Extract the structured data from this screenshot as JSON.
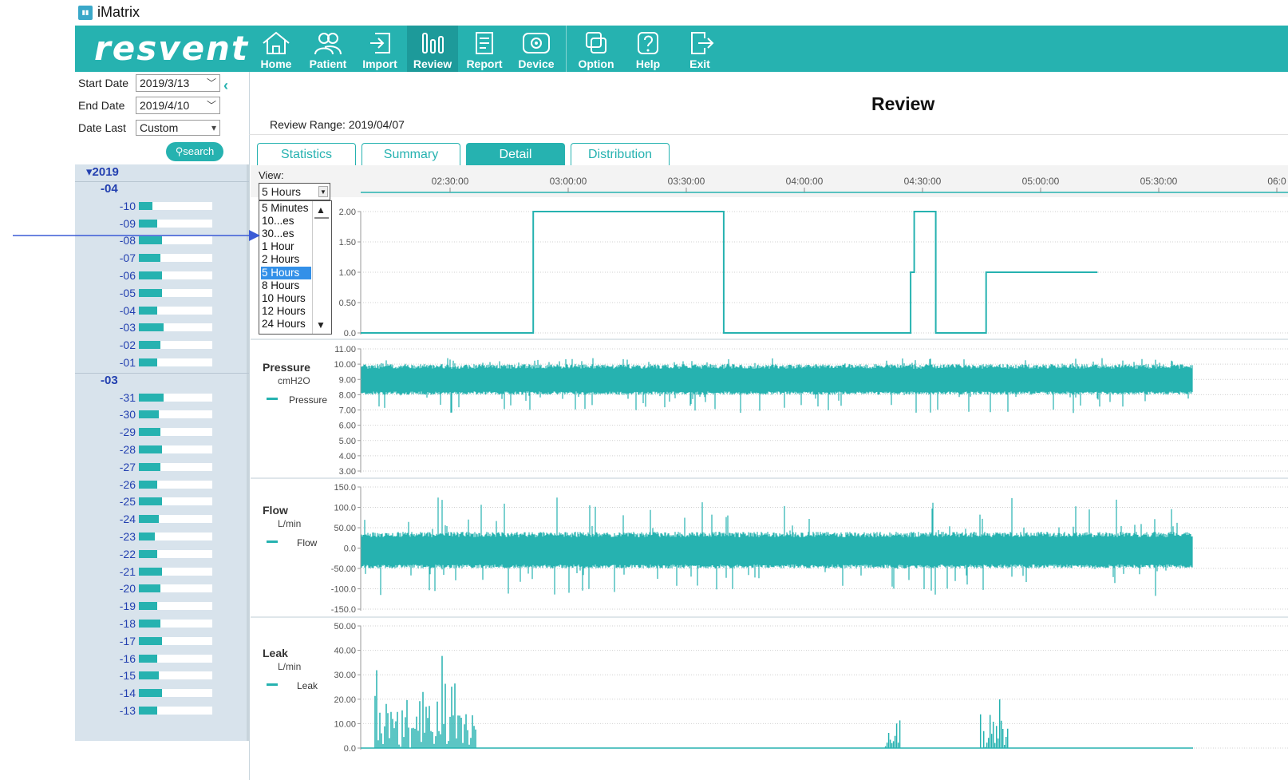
{
  "app": {
    "title": "iMatrix",
    "icon": "app-icon"
  },
  "brand": {
    "logo_text": "resvent",
    "accent_color": "#26b2b0",
    "active_color": "#1d9a9a"
  },
  "toolbar": {
    "items": [
      {
        "label": "Home",
        "icon": "home-icon"
      },
      {
        "label": "Patient",
        "icon": "patient-icon"
      },
      {
        "label": "Import",
        "icon": "import-icon"
      },
      {
        "label": "Review",
        "icon": "review-icon",
        "active": true
      },
      {
        "label": "Report",
        "icon": "report-icon"
      },
      {
        "label": "Device",
        "icon": "device-icon"
      },
      {
        "label": "Option",
        "icon": "option-icon"
      },
      {
        "label": "Help",
        "icon": "help-icon"
      },
      {
        "label": "Exit",
        "icon": "exit-icon"
      }
    ]
  },
  "filters": {
    "start_date_label": "Start Date",
    "start_date": "2019/3/13",
    "end_date_label": "End Date",
    "end_date": "2019/4/10",
    "date_last_label": "Date Last",
    "date_last": "Custom",
    "search_label": "search"
  },
  "tree": {
    "year": "2019",
    "months": [
      {
        "label": "04",
        "days": [
          {
            "d": "10",
            "v": 0.18
          },
          {
            "d": "09",
            "v": 0.25
          },
          {
            "d": "08",
            "v": 0.31
          },
          {
            "d": "07",
            "v": 0.29
          },
          {
            "d": "06",
            "v": 0.31
          },
          {
            "d": "05",
            "v": 0.31
          },
          {
            "d": "04",
            "v": 0.25
          },
          {
            "d": "03",
            "v": 0.34
          },
          {
            "d": "02",
            "v": 0.29
          },
          {
            "d": "01",
            "v": 0.25
          }
        ]
      },
      {
        "label": "03",
        "days": [
          {
            "d": "31",
            "v": 0.34
          },
          {
            "d": "30",
            "v": 0.27
          },
          {
            "d": "29",
            "v": 0.29
          },
          {
            "d": "28",
            "v": 0.31
          },
          {
            "d": "27",
            "v": 0.29
          },
          {
            "d": "26",
            "v": 0.25
          },
          {
            "d": "25",
            "v": 0.31
          },
          {
            "d": "24",
            "v": 0.27
          },
          {
            "d": "23",
            "v": 0.22
          },
          {
            "d": "22",
            "v": 0.25
          },
          {
            "d": "21",
            "v": 0.31
          },
          {
            "d": "20",
            "v": 0.29
          },
          {
            "d": "19",
            "v": 0.25
          },
          {
            "d": "18",
            "v": 0.29
          },
          {
            "d": "17",
            "v": 0.31
          },
          {
            "d": "16",
            "v": 0.25
          },
          {
            "d": "15",
            "v": 0.27
          },
          {
            "d": "14",
            "v": 0.31
          },
          {
            "d": "13",
            "v": 0.25
          }
        ]
      }
    ]
  },
  "main": {
    "title": "Review",
    "review_range": "Review Range: 2019/04/07",
    "tabs": [
      {
        "label": "Statistics",
        "active": false
      },
      {
        "label": "Summary",
        "active": false
      },
      {
        "label": "Detail",
        "active": true
      },
      {
        "label": "Distribution",
        "active": false
      }
    ]
  },
  "view": {
    "label": "View:",
    "selected": "5 Hours",
    "options": [
      "5 Minutes",
      "10...es",
      "30...es",
      "1 Hour",
      "2 Hours",
      "5 Hours",
      "8 Hours",
      "10 Hours",
      "12 Hours",
      "24 Hours"
    ]
  },
  "chart_data": [
    {
      "type": "line",
      "title": "",
      "x_ticks": [
        "02:30:00",
        "03:00:00",
        "03:30:00",
        "04:00:00",
        "04:30:00",
        "05:00:00",
        "05:30:00",
        "06:0"
      ],
      "x_range": [
        "02:12:00",
        "06:30:00"
      ],
      "y_ticks": [
        "2.00",
        "1.50",
        "1.00",
        "0.50",
        "0.0"
      ],
      "ylim": [
        0,
        2
      ],
      "series": [
        {
          "x": [
            "02:12:00",
            "03:00:00",
            "03:00:00",
            "03:53:00",
            "03:53:00",
            "04:45:00",
            "04:45:00",
            "04:46:00",
            "04:46:00",
            "04:52:00",
            "04:52:00",
            "05:06:00",
            "05:06:00",
            "05:37:00"
          ],
          "values": [
            0,
            0,
            2,
            2,
            0,
            0,
            1,
            1,
            2,
            2,
            0,
            0,
            1,
            1
          ]
        }
      ]
    },
    {
      "type": "line",
      "name": "Pressure",
      "unit": "cmH2O",
      "legend": "Pressure",
      "y_ticks": [
        "11.00",
        "10.00",
        "9.00",
        "8.00",
        "7.00",
        "6.00",
        "5.00",
        "4.00",
        "3.00"
      ],
      "ylim": [
        3,
        11
      ],
      "band": {
        "low": 8.0,
        "high": 10.0,
        "min_spike": 6.8,
        "max_spike": 10.4
      }
    },
    {
      "type": "line",
      "name": "Flow",
      "unit": "L/min",
      "legend": "Flow",
      "y_ticks": [
        "150.0",
        "100.0",
        "50.00",
        "0.0",
        "-50.00",
        "-100.0",
        "-150.0"
      ],
      "ylim": [
        -150,
        150
      ],
      "band": {
        "low": -50,
        "high": 40,
        "min_spike": -120,
        "max_spike": 125
      }
    },
    {
      "type": "line",
      "name": "Leak",
      "unit": "L/min",
      "legend": "Leak",
      "y_ticks": [
        "50.00",
        "40.00",
        "30.00",
        "20.00",
        "10.00",
        "0.0"
      ],
      "ylim": [
        0,
        50
      ],
      "bursts": [
        {
          "from": "02:16:00",
          "to": "02:44:00",
          "max": 40
        },
        {
          "from": "04:38:00",
          "to": "04:42:00",
          "max": 20
        },
        {
          "from": "05:04:00",
          "to": "05:12:00",
          "max": 25
        }
      ]
    }
  ]
}
